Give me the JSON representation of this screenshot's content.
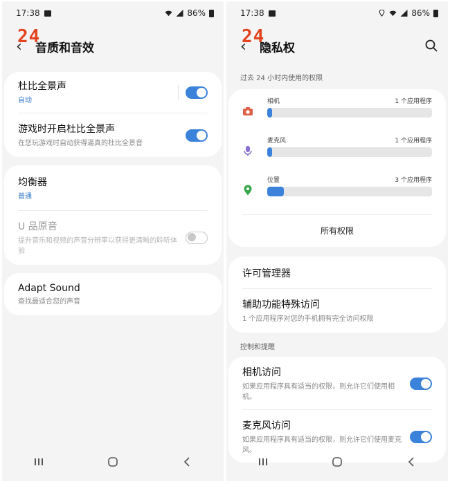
{
  "left": {
    "status": {
      "time": "17:38",
      "battery": "86%"
    },
    "title": "音质和音效",
    "items": [
      {
        "title": "杜比全景声",
        "sub": "自动"
      },
      {
        "title": "游戏时开启杜比全景声",
        "sub": "在您玩游戏时自动获得逼真的杜比全景音"
      },
      {
        "title": "均衡器",
        "sub": "普通"
      },
      {
        "title": "U 品原音",
        "sub": "提升音乐和视频的声音分辨率以获得更清晰的聆听体验"
      },
      {
        "title": "Adapt Sound",
        "sub": "查找最适合您的声音"
      }
    ]
  },
  "right": {
    "status": {
      "time": "17:38",
      "battery": "86%"
    },
    "title": "隐私权",
    "section_recent": "过去 24 小时内使用的权限",
    "permissions": [
      {
        "name": "相机",
        "count": "1 个应用程序",
        "fill": 0.03,
        "icon": "camera-icon",
        "color": "#e0604c"
      },
      {
        "name": "麦克风",
        "count": "1 个应用程序",
        "fill": 0.03,
        "icon": "mic-icon",
        "color": "#8a6fd6"
      },
      {
        "name": "位置",
        "count": "3 个应用程序",
        "fill": 0.1,
        "icon": "location-icon",
        "color": "#3aa84a"
      }
    ],
    "all_permissions": "所有权限",
    "permission_manager": "许可管理器",
    "accessibility": {
      "title": "辅助功能特殊访问",
      "sub": "1 个应用程序对您的手机拥有完全访问权限"
    },
    "section_controls": "控制和提醒",
    "camera_access": {
      "title": "相机访问",
      "sub": "如果应用程序具有适当的权限，则允许它们使用相机。"
    },
    "mic_access": {
      "title": "麦克风访问",
      "sub": "如果应用程序具有适当的权限，则允许它们使用麦克风。"
    }
  },
  "logo": "24",
  "colors": {
    "accent": "#3b82db",
    "logo": "#e2441f",
    "background": "#f4f4f4"
  }
}
